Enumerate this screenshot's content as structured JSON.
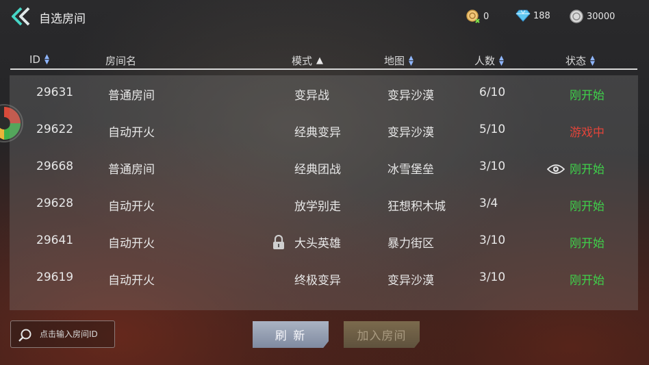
{
  "header": {
    "title": "自选房间",
    "coupon": "0",
    "diamonds": "188",
    "coins": "30000"
  },
  "columns": [
    {
      "label": "ID"
    },
    {
      "label": "房间名"
    },
    {
      "label": "模式"
    },
    {
      "label": "地图"
    },
    {
      "label": "人数"
    },
    {
      "label": "状态"
    }
  ],
  "rows": [
    {
      "id": "29631",
      "name": "普通房间",
      "mode": "变异战",
      "map": "变异沙漠",
      "count": "6/10",
      "status": "刚开始",
      "locked": false,
      "spectate": false
    },
    {
      "id": "29622",
      "name": "自动开火",
      "mode": "经典变异",
      "map": "变异沙漠",
      "count": "5/10",
      "status": "游戏中",
      "locked": false,
      "spectate": false
    },
    {
      "id": "29668",
      "name": "普通房间",
      "mode": "经典团战",
      "map": "冰雪堡垒",
      "count": "3/10",
      "status": "刚开始",
      "locked": false,
      "spectate": true
    },
    {
      "id": "29628",
      "name": "自动开火",
      "mode": "放学别走",
      "map": "狂想积木城",
      "count": "3/4",
      "status": "刚开始",
      "locked": false,
      "spectate": false
    },
    {
      "id": "29641",
      "name": "自动开火",
      "mode": "大头英雄",
      "map": "暴力街区",
      "count": "3/10",
      "status": "刚开始",
      "locked": true,
      "spectate": false
    },
    {
      "id": "29619",
      "name": "自动开火",
      "mode": "终极变异",
      "map": "变异沙漠",
      "count": "3/10",
      "status": "刚开始",
      "locked": false,
      "spectate": false
    }
  ],
  "status_colors": {
    "刚开始": "#3fd14a",
    "游戏中": "#e2443a"
  },
  "search": {
    "placeholder": "点击输入房间ID"
  },
  "buttons": {
    "refresh": "刷 新",
    "join": "加入房间"
  },
  "colors": {
    "accent": "#46d6c6",
    "refresh_bg": "#9aa4b7",
    "join_bg": "#6e5f47"
  }
}
